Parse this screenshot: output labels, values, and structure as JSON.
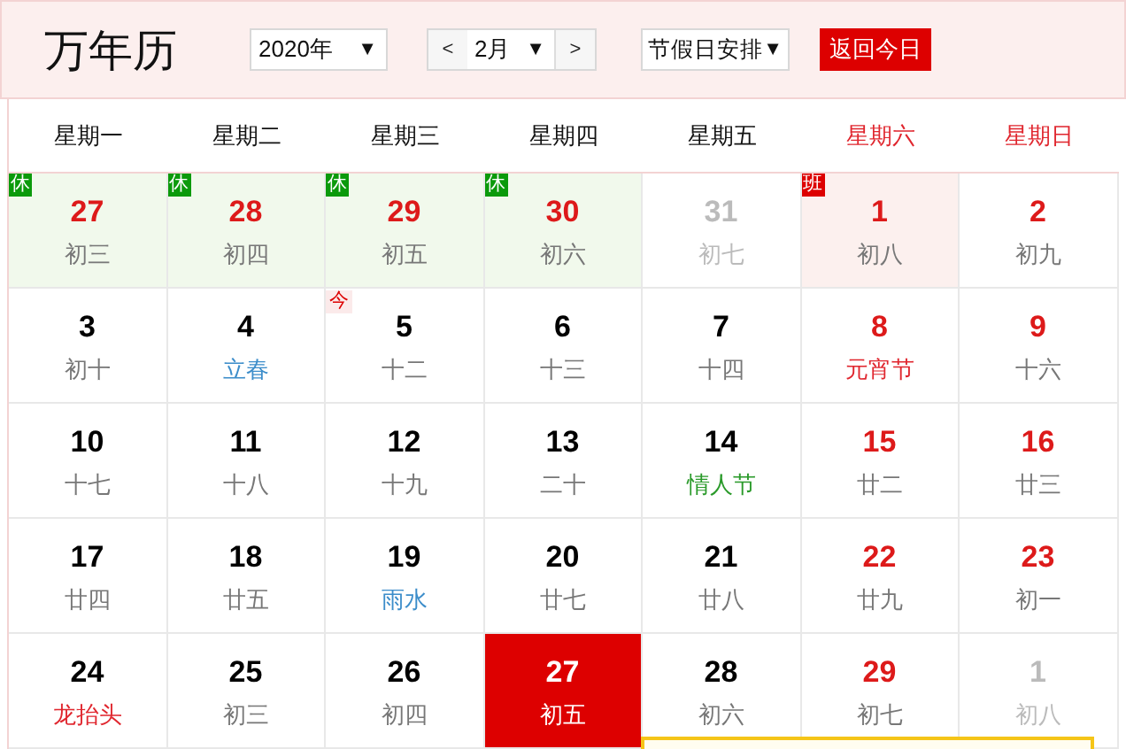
{
  "header": {
    "title": "万年历",
    "year_select": "2020年",
    "prev_month": "<",
    "month_select": "2月",
    "next_month": ">",
    "holiday_select": "节假日安排",
    "today_button": "返回今日",
    "dropdown_arrows": [
      "▼",
      "▼",
      "▼"
    ]
  },
  "weekdays": [
    {
      "label": "星期一",
      "weekend": false
    },
    {
      "label": "星期二",
      "weekend": false
    },
    {
      "label": "星期三",
      "weekend": false
    },
    {
      "label": "星期四",
      "weekend": false
    },
    {
      "label": "星期五",
      "weekend": false
    },
    {
      "label": "星期六",
      "weekend": true
    },
    {
      "label": "星期日",
      "weekend": true
    }
  ],
  "days": [
    {
      "day": "27",
      "lunar": "初三",
      "red": true,
      "other_month": false,
      "selected": false,
      "badge": {
        "kind": "rest",
        "text": "休"
      },
      "kind": "plain"
    },
    {
      "day": "28",
      "lunar": "初四",
      "red": true,
      "other_month": false,
      "selected": false,
      "badge": {
        "kind": "rest",
        "text": "休"
      },
      "kind": "plain"
    },
    {
      "day": "29",
      "lunar": "初五",
      "red": true,
      "other_month": false,
      "selected": false,
      "badge": {
        "kind": "rest",
        "text": "休"
      },
      "kind": "plain"
    },
    {
      "day": "30",
      "lunar": "初六",
      "red": true,
      "other_month": false,
      "selected": false,
      "badge": {
        "kind": "rest",
        "text": "休"
      },
      "kind": "plain"
    },
    {
      "day": "31",
      "lunar": "初七",
      "other_month": true,
      "selected": false
    },
    {
      "day": "1",
      "lunar": "初八",
      "red": true,
      "other_month": false,
      "selected": false,
      "badge": {
        "kind": "work",
        "text": "班"
      },
      "kind": "plain"
    },
    {
      "day": "2",
      "lunar": "初九",
      "red": true,
      "other_month": false,
      "selected": false,
      "kind": "plain"
    },
    {
      "day": "3",
      "lunar": "初十",
      "red": false,
      "other_month": false,
      "selected": false,
      "kind": "plain"
    },
    {
      "day": "4",
      "lunar": "立春",
      "red": false,
      "other_month": false,
      "selected": false,
      "kind": "term"
    },
    {
      "day": "5",
      "lunar": "十二",
      "red": false,
      "other_month": false,
      "today_mark": "今",
      "selected": false,
      "kind": "plain"
    },
    {
      "day": "6",
      "lunar": "十三",
      "red": false,
      "other_month": false,
      "selected": false,
      "kind": "plain"
    },
    {
      "day": "7",
      "lunar": "十四",
      "red": false,
      "other_month": false,
      "selected": false,
      "kind": "plain"
    },
    {
      "day": "8",
      "lunar": "元宵节",
      "red": true,
      "other_month": false,
      "selected": false,
      "kind": "festival"
    },
    {
      "day": "9",
      "lunar": "十六",
      "red": true,
      "other_month": false,
      "selected": false,
      "kind": "plain"
    },
    {
      "day": "10",
      "lunar": "十七",
      "red": false,
      "other_month": false,
      "selected": false,
      "kind": "plain"
    },
    {
      "day": "11",
      "lunar": "十八",
      "red": false,
      "other_month": false,
      "selected": false,
      "kind": "plain"
    },
    {
      "day": "12",
      "lunar": "十九",
      "red": false,
      "other_month": false,
      "selected": false,
      "kind": "plain"
    },
    {
      "day": "13",
      "lunar": "二十",
      "red": false,
      "other_month": false,
      "selected": false,
      "kind": "plain"
    },
    {
      "day": "14",
      "lunar": "情人节",
      "red": false,
      "other_month": false,
      "selected": false,
      "kind": "western"
    },
    {
      "day": "15",
      "lunar": "廿二",
      "red": true,
      "other_month": false,
      "selected": false,
      "kind": "plain"
    },
    {
      "day": "16",
      "lunar": "廿三",
      "red": true,
      "other_month": false,
      "selected": false,
      "kind": "plain"
    },
    {
      "day": "17",
      "lunar": "廿四",
      "red": false,
      "other_month": false,
      "selected": false,
      "kind": "plain"
    },
    {
      "day": "18",
      "lunar": "廿五",
      "red": false,
      "other_month": false,
      "selected": false,
      "kind": "plain"
    },
    {
      "day": "19",
      "lunar": "雨水",
      "red": false,
      "other_month": false,
      "selected": false,
      "kind": "term"
    },
    {
      "day": "20",
      "lunar": "廿七",
      "red": false,
      "other_month": false,
      "selected": false,
      "kind": "plain"
    },
    {
      "day": "21",
      "lunar": "廿八",
      "red": false,
      "other_month": false,
      "selected": false,
      "kind": "plain"
    },
    {
      "day": "22",
      "lunar": "廿九",
      "red": true,
      "other_month": false,
      "selected": false,
      "kind": "plain"
    },
    {
      "day": "23",
      "lunar": "初一",
      "red": true,
      "other_month": false,
      "selected": false,
      "kind": "plain"
    },
    {
      "day": "24",
      "lunar": "龙抬头",
      "red": false,
      "other_month": false,
      "selected": false,
      "kind": "festival"
    },
    {
      "day": "25",
      "lunar": "初三",
      "red": false,
      "other_month": false,
      "selected": false,
      "kind": "plain"
    },
    {
      "day": "26",
      "lunar": "初四",
      "red": false,
      "other_month": false,
      "selected": false,
      "kind": "plain"
    },
    {
      "day": "27",
      "lunar": "初五",
      "red": false,
      "other_month": false,
      "selected": true,
      "kind": "plain"
    },
    {
      "day": "28",
      "lunar": "初六",
      "red": false,
      "other_month": false,
      "selected": false,
      "kind": "plain"
    },
    {
      "day": "29",
      "lunar": "初七",
      "red": true,
      "other_month": false,
      "selected": false,
      "kind": "plain"
    },
    {
      "day": "1",
      "lunar": "初八",
      "other_month": true,
      "selected": false
    }
  ],
  "detail_popup": {
    "kind": "popup"
  }
}
